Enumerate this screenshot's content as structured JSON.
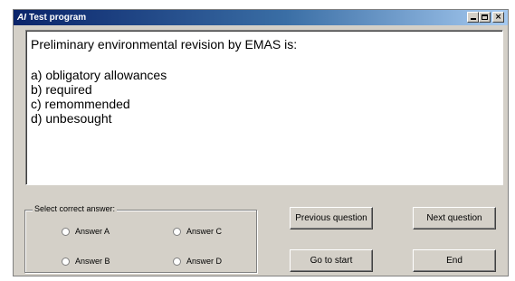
{
  "window": {
    "app_icon": "AI",
    "title": "Test program"
  },
  "question": {
    "text": "Preliminary environmental revision by EMAS is:",
    "options": [
      "a) obligatory allowances",
      "b) required",
      "c) remommended",
      "d) unbesought"
    ]
  },
  "answers": {
    "group_label": "Select correct answer:",
    "a": "Answer A",
    "b": "Answer B",
    "c": "Answer C",
    "d": "Answer D"
  },
  "buttons": {
    "previous": "Previous question",
    "next": "Next question",
    "go_to_start": "Go to start",
    "end": "End"
  }
}
